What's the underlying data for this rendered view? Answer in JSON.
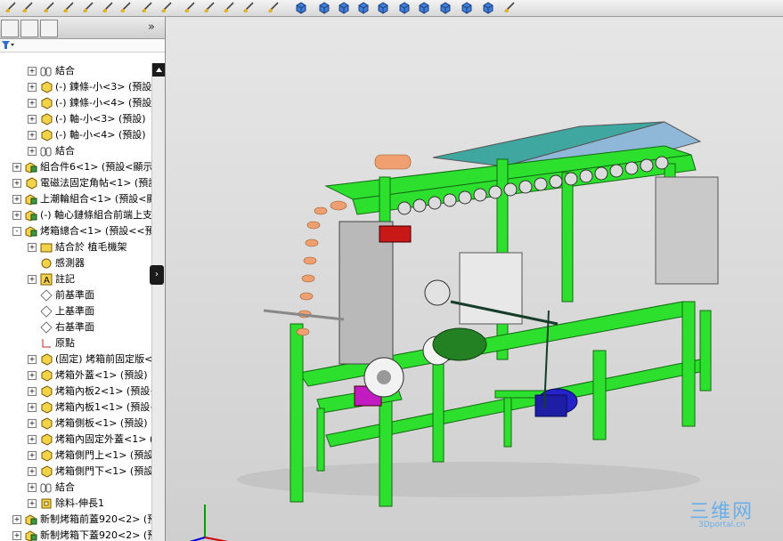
{
  "toolbar": {
    "icons": [
      "sketch-icon",
      "smart-dimension-icon",
      "line-icon",
      "rectangle-icon",
      "circle-icon",
      "arc-icon",
      "spline-icon",
      "point-icon",
      "trim-icon",
      "grid-icon",
      "mirror-icon",
      "offset-icon",
      "undo-icon",
      "view-orientation-icon",
      "cube-icon",
      "cube-icon",
      "cube-icon",
      "cube-icon",
      "cube-icon",
      "cube-icon",
      "cube-icon",
      "cube-icon",
      "cube-icon",
      "cube-icon",
      "measure-icon"
    ]
  },
  "panel": {
    "tabs": [
      "feature-manager-tab",
      "property-manager-tab",
      "configuration-manager-tab"
    ],
    "expand_arrows": "»",
    "tree": [
      {
        "indent": 1,
        "expander": "+",
        "icon": "mate-icon",
        "label": "結合"
      },
      {
        "indent": 1,
        "expander": "+",
        "icon": "part-icon",
        "label": "(-) 鍊條-小<3> (預設)"
      },
      {
        "indent": 1,
        "expander": "+",
        "icon": "part-icon",
        "label": "(-) 鍊條-小<4> (預設)"
      },
      {
        "indent": 1,
        "expander": "+",
        "icon": "part-icon",
        "label": "(-) 軸-小<3> (預設)"
      },
      {
        "indent": 1,
        "expander": "+",
        "icon": "part-icon",
        "label": "(-) 軸-小<4> (預設)"
      },
      {
        "indent": 1,
        "expander": "+",
        "icon": "mate-icon",
        "label": "結合"
      },
      {
        "indent": 0,
        "expander": "+",
        "icon": "assembly-icon",
        "label": "組合件6<1> (預設<顯示狀"
      },
      {
        "indent": 0,
        "expander": "+",
        "icon": "part-icon",
        "label": "電磁法固定角帖<1> (預設"
      },
      {
        "indent": 0,
        "expander": "+",
        "icon": "assembly-icon",
        "label": "上潮輪組合<1> (預設<顯示"
      },
      {
        "indent": 0,
        "expander": "+",
        "icon": "assembly-icon",
        "label": "(-) 軸心鏈條組合前端上支3"
      },
      {
        "indent": 0,
        "expander": "-",
        "icon": "assembly-icon",
        "label": "烤箱總合<1> (預設<<預設"
      },
      {
        "indent": 1,
        "expander": "+",
        "icon": "folder-icon",
        "label": "結合於 植毛機架"
      },
      {
        "indent": 1,
        "expander": "",
        "icon": "sensor-icon",
        "label": "感測器"
      },
      {
        "indent": 1,
        "expander": "+",
        "icon": "annotation-icon",
        "label": "註記"
      },
      {
        "indent": 1,
        "expander": "",
        "icon": "plane-icon",
        "label": "前基準面"
      },
      {
        "indent": 1,
        "expander": "",
        "icon": "plane-icon",
        "label": "上基準面"
      },
      {
        "indent": 1,
        "expander": "",
        "icon": "plane-icon",
        "label": "右基準面"
      },
      {
        "indent": 1,
        "expander": "",
        "icon": "origin-icon",
        "label": "原點"
      },
      {
        "indent": 1,
        "expander": "+",
        "icon": "part-icon",
        "label": "(固定) 烤箱前固定版<1"
      },
      {
        "indent": 1,
        "expander": "+",
        "icon": "part-icon",
        "label": "烤箱外蓋<1> (預設)"
      },
      {
        "indent": 1,
        "expander": "+",
        "icon": "part-icon",
        "label": "烤箱內板2<1> (預設<<"
      },
      {
        "indent": 1,
        "expander": "+",
        "icon": "part-icon",
        "label": "烤箱內板1<1> (預設<<"
      },
      {
        "indent": 1,
        "expander": "+",
        "icon": "part-icon",
        "label": "烤箱側板<1> (預設)"
      },
      {
        "indent": 1,
        "expander": "+",
        "icon": "part-icon",
        "label": "烤箱內固定外蓋<1> (預"
      },
      {
        "indent": 1,
        "expander": "+",
        "icon": "part-icon",
        "label": "烤箱側門上<1> (預設)"
      },
      {
        "indent": 1,
        "expander": "+",
        "icon": "part-icon",
        "label": "烤箱側門下<1> (預設)"
      },
      {
        "indent": 1,
        "expander": "+",
        "icon": "mate-icon",
        "label": "結合"
      },
      {
        "indent": 1,
        "expander": "+",
        "icon": "feature-icon",
        "label": "除料-伸長1"
      },
      {
        "indent": 0,
        "expander": "+",
        "icon": "assembly-icon",
        "label": "新制烤箱前蓋920<2> (預設"
      },
      {
        "indent": 0,
        "expander": "+",
        "icon": "assembly-icon",
        "label": "新制烤箱下蓋920<2> (預設"
      }
    ]
  },
  "viewport": {
    "watermark_main": "三维网",
    "watermark_sub": "3Dportal.cn"
  },
  "colors": {
    "frame_green": "#2ee02e",
    "cover_teal": "#3fa7a0",
    "motor_blue": "#2323c8",
    "accent_red": "#c81818",
    "accent_magenta": "#c21bc2",
    "roller_orange": "#f0a070"
  }
}
